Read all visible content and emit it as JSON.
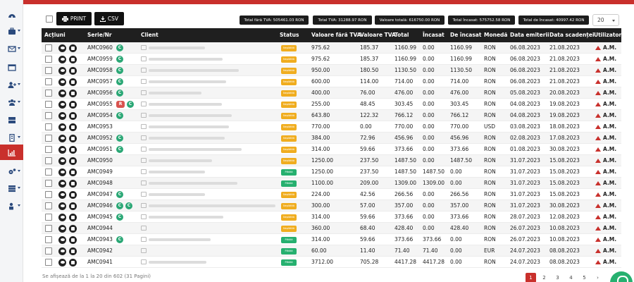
{
  "toolbar": {
    "print_label": "PRINT",
    "csv_label": "CSV",
    "totals": [
      "Total fără TVA: 505461.03 RON",
      "Total TVA: 31288.97 RON",
      "Valoare totală: 616750.00 RON",
      "Total încasat: 575752.58 RON",
      "Total de încasat: 40997.42 RON"
    ],
    "page_size": "20"
  },
  "table": {
    "headers": [
      "Acțiuni",
      "Serie/Nr",
      "Client",
      "Status",
      "Valoare fără TVA",
      "Valoare TVA",
      "Total",
      "Încasat",
      "De încasat",
      "Monedă",
      "Data emiterii",
      "Data scadenței",
      "Utilizator"
    ],
    "rows": [
      {
        "nr": "AMC0960",
        "tags": [
          "C"
        ],
        "status": "Neplătită",
        "paid": false,
        "net": "975.62",
        "vat": "185.37",
        "total": "1160.99",
        "cashed": "0.00",
        "due": "1160.99",
        "cur": "RON",
        "issued": "06.08.2023",
        "deadline": "21.08.2023",
        "user": "A.M."
      },
      {
        "nr": "AMC0959",
        "tags": [
          "C"
        ],
        "status": "Neplătită",
        "paid": false,
        "net": "975.62",
        "vat": "185.37",
        "total": "1160.99",
        "cashed": "0.00",
        "due": "1160.99",
        "cur": "RON",
        "issued": "06.08.2023",
        "deadline": "21.08.2023",
        "user": "A.M."
      },
      {
        "nr": "AMC0958",
        "tags": [
          "C"
        ],
        "status": "Neplătită",
        "paid": false,
        "net": "950.00",
        "vat": "180.50",
        "total": "1130.50",
        "cashed": "0.00",
        "due": "1130.50",
        "cur": "RON",
        "issued": "06.08.2023",
        "deadline": "21.08.2023",
        "user": "A.M."
      },
      {
        "nr": "AMC0957",
        "tags": [
          "C"
        ],
        "status": "Neplătită",
        "paid": false,
        "net": "600.00",
        "vat": "114.00",
        "total": "714.00",
        "cashed": "0.00",
        "due": "714.00",
        "cur": "RON",
        "issued": "06.08.2023",
        "deadline": "21.08.2023",
        "user": "A.M."
      },
      {
        "nr": "AMC0956",
        "tags": [
          "C"
        ],
        "status": "Neplătită",
        "paid": false,
        "net": "400.00",
        "vat": "76.00",
        "total": "476.00",
        "cashed": "0.00",
        "due": "476.00",
        "cur": "RON",
        "issued": "05.08.2023",
        "deadline": "20.08.2023",
        "user": "A.M."
      },
      {
        "nr": "AMC0955",
        "tags": [
          "R",
          "C"
        ],
        "status": "Neplătită",
        "paid": false,
        "net": "255.00",
        "vat": "48.45",
        "total": "303.45",
        "cashed": "0.00",
        "due": "303.45",
        "cur": "RON",
        "issued": "04.08.2023",
        "deadline": "19.08.2023",
        "user": "A.M."
      },
      {
        "nr": "AMC0954",
        "tags": [
          "C"
        ],
        "status": "Neplătită",
        "paid": false,
        "net": "643.80",
        "vat": "122.32",
        "total": "766.12",
        "cashed": "0.00",
        "due": "766.12",
        "cur": "RON",
        "issued": "04.08.2023",
        "deadline": "19.08.2023",
        "user": "A.M."
      },
      {
        "nr": "AMC0953",
        "tags": [],
        "status": "Neplătită",
        "paid": false,
        "net": "770.00",
        "vat": "0.00",
        "total": "770.00",
        "cashed": "0.00",
        "due": "770.00",
        "cur": "USD",
        "issued": "03.08.2023",
        "deadline": "18.08.2023",
        "user": "A.M."
      },
      {
        "nr": "AMC0952",
        "tags": [
          "C"
        ],
        "status": "Neplătită",
        "paid": false,
        "net": "384.00",
        "vat": "72.96",
        "total": "456.96",
        "cashed": "0.00",
        "due": "456.96",
        "cur": "RON",
        "issued": "02.08.2023",
        "deadline": "17.08.2023",
        "user": "A.M."
      },
      {
        "nr": "AMC0951",
        "tags": [
          "C"
        ],
        "status": "Neplătită",
        "paid": false,
        "net": "314.00",
        "vat": "59.66",
        "total": "373.66",
        "cashed": "0.00",
        "due": "373.66",
        "cur": "RON",
        "issued": "01.08.2023",
        "deadline": "30.08.2023",
        "user": "A.M."
      },
      {
        "nr": "AMC0950",
        "tags": [],
        "status": "Neplătită",
        "paid": false,
        "net": "1250.00",
        "vat": "237.50",
        "total": "1487.50",
        "cashed": "0.00",
        "due": "1487.50",
        "cur": "RON",
        "issued": "31.07.2023",
        "deadline": "15.08.2023",
        "user": "A.M."
      },
      {
        "nr": "AMC0949",
        "tags": [],
        "status": "Plătită",
        "paid": true,
        "net": "1250.00",
        "vat": "237.50",
        "total": "1487.50",
        "cashed": "1487.50",
        "due": "0.00",
        "cur": "RON",
        "issued": "31.07.2023",
        "deadline": "15.08.2023",
        "user": "A.M."
      },
      {
        "nr": "AMC0948",
        "tags": [],
        "status": "Plătită",
        "paid": true,
        "net": "1100.00",
        "vat": "209.00",
        "total": "1309.00",
        "cashed": "1309.00",
        "due": "0.00",
        "cur": "RON",
        "issued": "31.07.2023",
        "deadline": "15.08.2023",
        "user": "A.M."
      },
      {
        "nr": "AMC0947",
        "tags": [
          "C"
        ],
        "status": "Neplătită",
        "paid": false,
        "net": "224.00",
        "vat": "42.56",
        "total": "266.56",
        "cashed": "0.00",
        "due": "266.56",
        "cur": "RON",
        "issued": "31.07.2023",
        "deadline": "15.08.2023",
        "user": "A.M."
      },
      {
        "nr": "AMC0946",
        "tags": [
          "C",
          "C"
        ],
        "status": "Neplătită",
        "paid": false,
        "net": "300.00",
        "vat": "57.00",
        "total": "357.00",
        "cashed": "0.00",
        "due": "357.00",
        "cur": "RON",
        "issued": "31.07.2023",
        "deadline": "30.08.2023",
        "user": "A.M."
      },
      {
        "nr": "AMC0945",
        "tags": [
          "C"
        ],
        "status": "Neplătită",
        "paid": false,
        "net": "314.00",
        "vat": "59.66",
        "total": "373.66",
        "cashed": "0.00",
        "due": "373.66",
        "cur": "RON",
        "issued": "28.07.2023",
        "deadline": "12.08.2023",
        "user": "A.M."
      },
      {
        "nr": "AMC0944",
        "tags": [],
        "status": "Neplătită",
        "paid": false,
        "net": "360.00",
        "vat": "68.40",
        "total": "428.40",
        "cashed": "0.00",
        "due": "428.40",
        "cur": "RON",
        "issued": "26.07.2023",
        "deadline": "10.08.2023",
        "user": "A.M."
      },
      {
        "nr": "AMC0943",
        "tags": [
          "C"
        ],
        "status": "Plătită",
        "paid": true,
        "net": "314.00",
        "vat": "59.66",
        "total": "373.66",
        "cashed": "373.66",
        "due": "0.00",
        "cur": "RON",
        "issued": "26.07.2023",
        "deadline": "10.08.2023",
        "user": "A.M."
      },
      {
        "nr": "AMC0942",
        "tags": [],
        "status": "Plătită",
        "paid": true,
        "net": "60.00",
        "vat": "11.40",
        "total": "71.40",
        "cashed": "71.40",
        "due": "0.00",
        "cur": "EUR",
        "issued": "24.07.2023",
        "deadline": "08.08.2023",
        "user": "A.M."
      },
      {
        "nr": "AMC0941",
        "tags": [],
        "status": "Plătită",
        "paid": true,
        "net": "3712.00",
        "vat": "705.28",
        "total": "4417.28",
        "cashed": "4417.28",
        "due": "0.00",
        "cur": "RON",
        "issued": "24.07.2023",
        "deadline": "08.08.2023",
        "user": "A.M."
      }
    ]
  },
  "footer": {
    "info": "Se afișează de la 1 la 20 din 602 (31 Pagini)",
    "pages": [
      "1",
      "2",
      "3",
      "4",
      "5",
      "›"
    ]
  },
  "sidebar": {
    "items": [
      "dashboard-icon",
      "briefcase-icon",
      "envelope-icon",
      "calendar-icon",
      "add-user-icon",
      "users-icon",
      "cards-icon",
      "building-icon",
      "chart-icon",
      "settings-icon",
      "server-icon",
      "lock-user-icon"
    ]
  },
  "colors": {
    "accent": "#c9302c",
    "unpaid": "#f0ad1f",
    "paid": "#26b06f",
    "header": "#1f1f1f"
  }
}
